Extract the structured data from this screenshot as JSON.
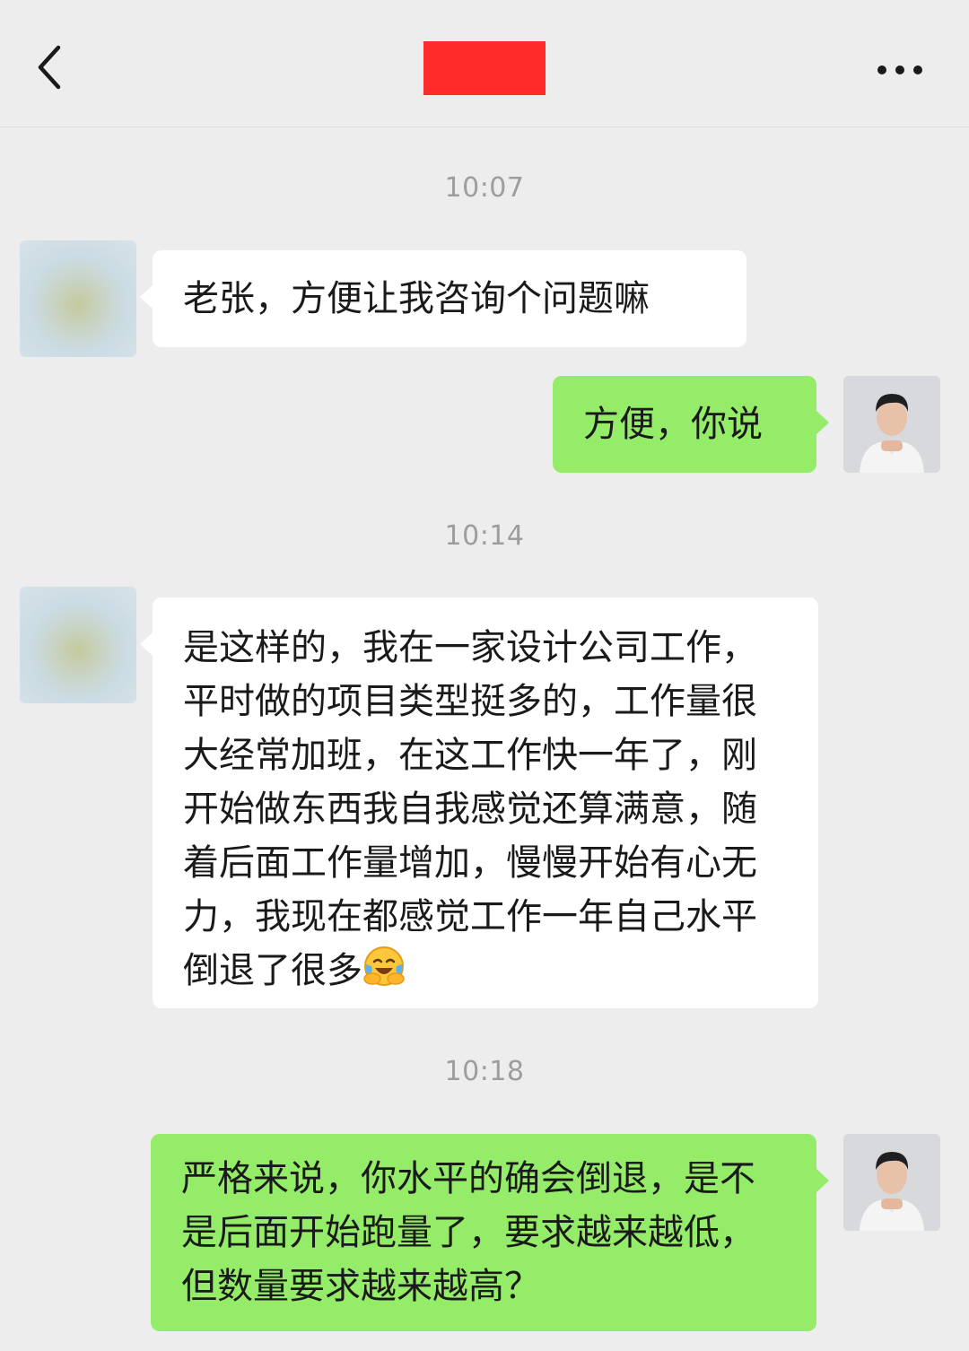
{
  "header": {
    "back_icon": "chevron-left-icon",
    "title_redacted_color": "#ff2b2b",
    "more_icon": "more-dots-icon"
  },
  "chat": {
    "timestamps": [
      "10:07",
      "10:14",
      "10:18"
    ],
    "messages": [
      {
        "side": "left",
        "text": "老张，方便让我咨询个问题嘛"
      },
      {
        "side": "right",
        "text": "方便，你说"
      },
      {
        "side": "left",
        "text": "是这样的，我在一家设计公司工作，平时做的项目类型挺多的，工作量很大经常加班，在这工作快一年了，刚开始做东西我自我感觉还算满意，随着后面工作量增加，慢慢开始有心无力，我现在都感觉工作一年自己水平倒退了很多",
        "emoji": "laughing-crying-emoji"
      },
      {
        "side": "right",
        "text": "严格来说，你水平的确会倒退，是不是后面开始跑量了，要求越来越低，但数量要求越来越高？"
      }
    ]
  },
  "colors": {
    "background": "#ededed",
    "bubble_self": "#95ec69",
    "bubble_other": "#ffffff",
    "timestamp_text": "#9d9d9d"
  }
}
